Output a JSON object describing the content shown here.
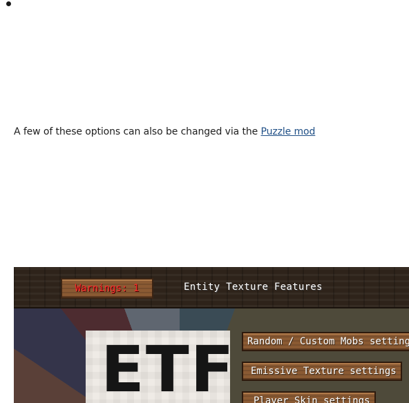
{
  "note": {
    "prefix": "A few of these options can also be changed via the ",
    "link_label": "Puzzle mod"
  },
  "screenshot": {
    "warnings_label": "Warnings: 1",
    "title": "Entity Texture Features",
    "logo_text": "ETF",
    "buttons": [
      {
        "label": "Random / Custom Mobs settings"
      },
      {
        "label": "Emissive Texture settings"
      },
      {
        "label": "Player Skin settings"
      }
    ],
    "colors": {
      "warning_text": "#ff2b2b",
      "button_wood": "#8a5a33",
      "link": "#1f4f86"
    }
  }
}
